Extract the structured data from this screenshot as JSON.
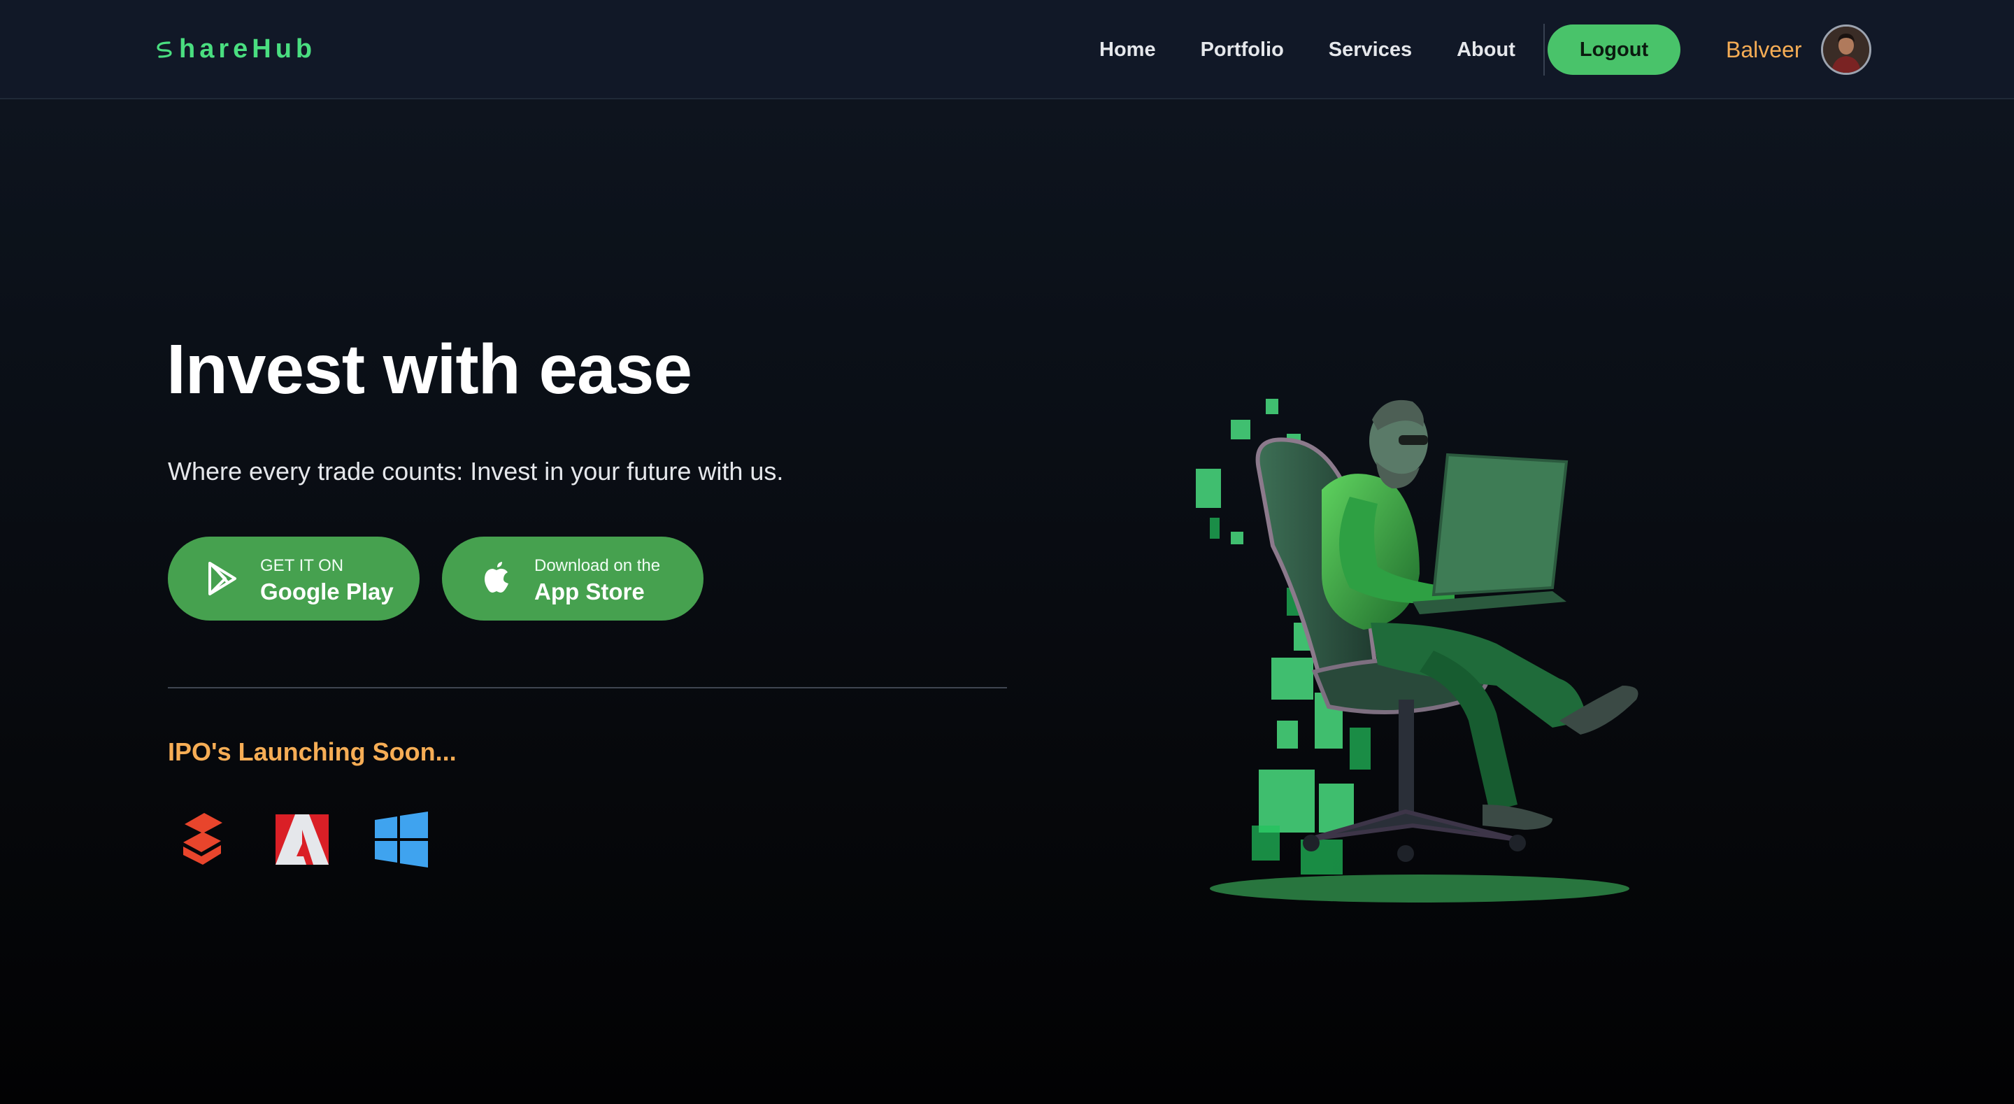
{
  "navbar": {
    "brand": "ShareHub",
    "brand_rest": "hareHub",
    "links": [
      "Home",
      "Portfolio",
      "Services",
      "About"
    ],
    "logout_label": "Logout",
    "username": "Balveer"
  },
  "hero": {
    "title": "Invest with ease",
    "subtitle": "Where every trade counts: Invest in your future with us.",
    "google_play": {
      "small": "GET IT ON",
      "big": "Google Play"
    },
    "app_store": {
      "small": "Download on the",
      "big": "App Store"
    }
  },
  "ipo": {
    "heading": "IPO's Launching Soon...",
    "logos": [
      "suzuki-logo",
      "adobe-logo",
      "windows-logo"
    ]
  },
  "colors": {
    "accent_green": "#49c36a",
    "button_green": "#46a14f",
    "brand_green": "#4ade80",
    "orange": "#f6ad55",
    "nav_bg": "#111827"
  }
}
